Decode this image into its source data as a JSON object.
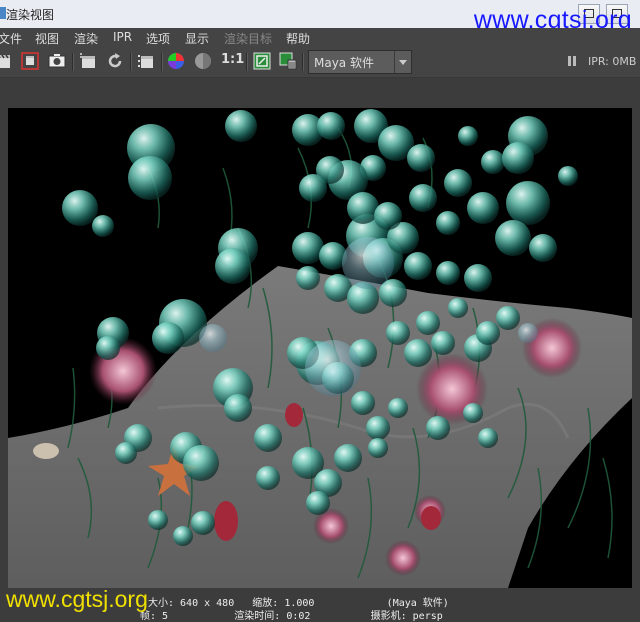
{
  "window": {
    "title": "渲染视图"
  },
  "watermark": "www.cgtsj.org",
  "menu": [
    {
      "label": "文件",
      "disabled": false
    },
    {
      "label": "视图",
      "disabled": false
    },
    {
      "label": "渲染",
      "disabled": false
    },
    {
      "label": "IPR",
      "disabled": false
    },
    {
      "label": "选项",
      "disabled": false
    },
    {
      "label": "显示",
      "disabled": false
    },
    {
      "label": "渲染目标",
      "disabled": true
    },
    {
      "label": "帮助",
      "disabled": false
    }
  ],
  "toolbar": {
    "icons": [
      "clapper-icon",
      "render-region-icon",
      "snapshot-camera-icon",
      "ipr-render-icon",
      "refresh-icon",
      "render-sequence-icon",
      "color-channels-icon",
      "alpha-channel-icon",
      "real-size-icon",
      "keep-image-icon",
      "remove-image-icon"
    ],
    "ratio_label": "1:1",
    "renderer": "Maya 软件",
    "ipr_memory": "IPR: 0MB"
  },
  "info": {
    "line1": "大小: 640 x 480   缩放: 1.000            (Maya 软件)",
    "line2": "帧: 5           渲染时间: 0:02          摄影机: persp"
  },
  "colors": {
    "watermark_top": "#1818ff",
    "watermark_bottom": "#f0e000",
    "panel": "#444444"
  }
}
